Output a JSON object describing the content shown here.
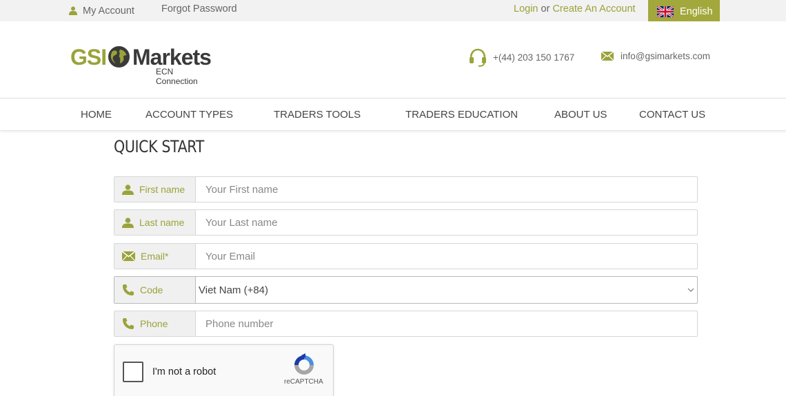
{
  "topbar": {
    "my_account": "My Account",
    "forgot_password": "Forgot Password",
    "login": "Login",
    "or": "or",
    "create_account": "Create An Account",
    "language": "English"
  },
  "header": {
    "logo_gsi": "GSI",
    "logo_markets": "Markets",
    "logo_tagline": "ECN Connection",
    "phone": "+(44) 203 150 1767",
    "email": "info@gsimarkets.com"
  },
  "nav": {
    "items": [
      "HOME",
      "ACCOUNT TYPES",
      "TRADERS TOOLS",
      "TRADERS EDUCATION",
      "ABOUT US",
      "CONTACT US"
    ]
  },
  "form": {
    "title": "QUICK START",
    "first_name": {
      "label": "First name",
      "placeholder": "Your First name"
    },
    "last_name": {
      "label": "Last name",
      "placeholder": "Your Last name"
    },
    "email": {
      "label": "Email*",
      "placeholder": "Your Email"
    },
    "code": {
      "label": "Code",
      "value": "Viet Nam (+84)"
    },
    "phone": {
      "label": "Phone",
      "placeholder": "Phone number"
    }
  },
  "captcha": {
    "text": "I'm not a robot",
    "brand": "reCAPTCHA"
  },
  "colors": {
    "accent": "#9aa33a",
    "lang_bg": "#a2a83b"
  }
}
